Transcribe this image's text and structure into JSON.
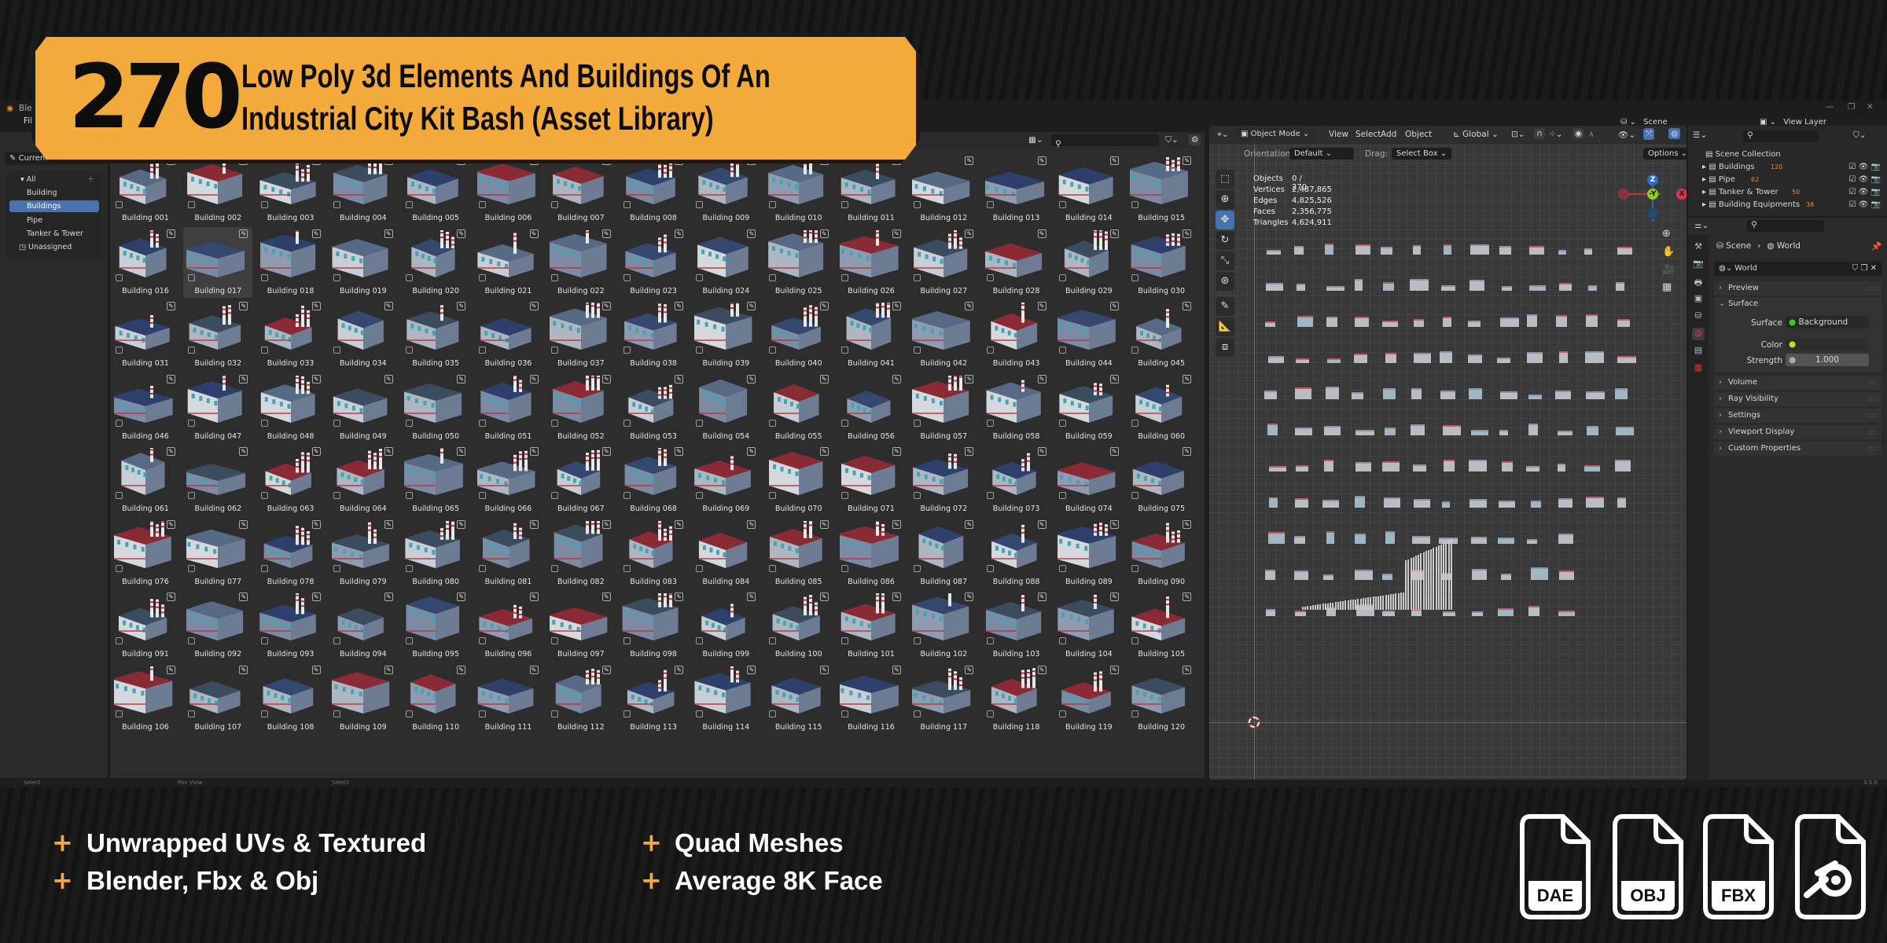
{
  "colors": {
    "accent": "#f4a93b",
    "selection": "#4772b3",
    "ui_bg": "#2d2d2d",
    "x_axis": "#d9364b",
    "y_axis": "#8bd11a",
    "z_axis": "#2c6bc9"
  },
  "banner": {
    "count": "270",
    "line1": "Low Poly 3d Elements And Buildings Of An",
    "line2": "Industrial City Kit Bash (Asset Library)"
  },
  "window": {
    "title": "Blender",
    "menu_file": "File",
    "minimize": "—",
    "maximize": "❐",
    "close": "✕"
  },
  "asset_browser": {
    "library": "Current File",
    "categories": [
      {
        "label": "All",
        "icon": "triangle-down-icon"
      },
      {
        "label": "Building Equipments"
      },
      {
        "label": "Buildings",
        "selected": true
      },
      {
        "label": "Pipe"
      },
      {
        "label": "Tanker & Tower"
      },
      {
        "label": "Unassigned",
        "icon": "unassigned-icon"
      }
    ],
    "selected_item": "Building 017",
    "items": [
      "Building 001",
      "Building 002",
      "Building 003",
      "Building 004",
      "Building 005",
      "Building 006",
      "Building 007",
      "Building 008",
      "Building 009",
      "Building 010",
      "Building 011",
      "Building 012",
      "Building 013",
      "Building 014",
      "Building 015",
      "Building 016",
      "Building 017",
      "Building 018",
      "Building 019",
      "Building 020",
      "Building 021",
      "Building 022",
      "Building 023",
      "Building 024",
      "Building 025",
      "Building 026",
      "Building 027",
      "Building 028",
      "Building 029",
      "Building 030",
      "Building 031",
      "Building 032",
      "Building 033",
      "Building 034",
      "Building 035",
      "Building 036",
      "Building 037",
      "Building 038",
      "Building 039",
      "Building 040",
      "Building 041",
      "Building 042",
      "Building 043",
      "Building 044",
      "Building 045",
      "Building 046",
      "Building 047",
      "Building 048",
      "Building 049",
      "Building 050",
      "Building 051",
      "Building 052",
      "Building 053",
      "Building 054",
      "Building 055",
      "Building 056",
      "Building 057",
      "Building 058",
      "Building 059",
      "Building 060",
      "Building 061",
      "Building 062",
      "Building 063",
      "Building 064",
      "Building 065",
      "Building 066",
      "Building 067",
      "Building 068",
      "Building 069",
      "Building 070",
      "Building 071",
      "Building 072",
      "Building 073",
      "Building 074",
      "Building 075",
      "Building 076",
      "Building 077",
      "Building 078",
      "Building 079",
      "Building 080",
      "Building 081",
      "Building 082",
      "Building 083",
      "Building 084",
      "Building 085",
      "Building 086",
      "Building 087",
      "Building 088",
      "Building 089",
      "Building 090",
      "Building 091",
      "Building 092",
      "Building 093",
      "Building 094",
      "Building 095",
      "Building 096",
      "Building 097",
      "Building 098",
      "Building 099",
      "Building 100",
      "Building 101",
      "Building 102",
      "Building 103",
      "Building 104",
      "Building 105",
      "Building 106",
      "Building 107",
      "Building 108",
      "Building 109",
      "Building 110",
      "Building 111",
      "Building 112",
      "Building 113",
      "Building 114",
      "Building 115",
      "Building 116",
      "Building 117",
      "Building 118",
      "Building 119",
      "Building 120"
    ]
  },
  "viewport": {
    "mode": "Object Mode",
    "menus": [
      "View",
      "Select",
      "Add",
      "Object"
    ],
    "transform_orientation": "Global",
    "orientation_label": "Orientation:",
    "orientation": "Default",
    "drag_label": "Drag:",
    "drag": "Select Box",
    "options": "Options",
    "stats": [
      {
        "label": "Objects",
        "value": "0 / 270"
      },
      {
        "label": "Vertices",
        "value": "2,487,865"
      },
      {
        "label": "Edges",
        "value": "4,825,526"
      },
      {
        "label": "Faces",
        "value": "2,356,775"
      },
      {
        "label": "Triangles",
        "value": "4,624,911"
      }
    ],
    "gizmo": {
      "z": "Z",
      "y": "-Y",
      "x": "X"
    }
  },
  "topbar": {
    "scene": "Scene",
    "view_layer": "View Layer"
  },
  "outliner": {
    "root": "Scene Collection",
    "collections": [
      {
        "name": "Buildings",
        "count": "120"
      },
      {
        "name": "Pipe",
        "count": "62"
      },
      {
        "name": "Tanker & Tower",
        "count": "50"
      },
      {
        "name": "Building Equipments",
        "count": "38"
      }
    ]
  },
  "properties": {
    "breadcrumb": [
      "Scene",
      "World"
    ],
    "world": "World",
    "panels": {
      "preview": "Preview",
      "surface": "Surface",
      "volume": "Volume",
      "ray_visibility": "Ray Visibility",
      "settings": "Settings",
      "viewport_display": "Viewport Display",
      "custom_properties": "Custom Properties"
    },
    "surface_label": "Surface",
    "surface_value": "Background",
    "color_label": "Color",
    "strength_label": "Strength",
    "strength_value": "1.000"
  },
  "status_bar": {
    "items": [
      "Select",
      "Pan View",
      "Select"
    ],
    "version": "3.5.0"
  },
  "features": [
    "Unwrapped UVs & Textured",
    "Blender, Fbx & Obj",
    "Quad Meshes",
    "Average 8K Face"
  ],
  "formats": [
    "DAE",
    "OBJ",
    "FBX"
  ],
  "blend_icon": "blender-logo-icon"
}
